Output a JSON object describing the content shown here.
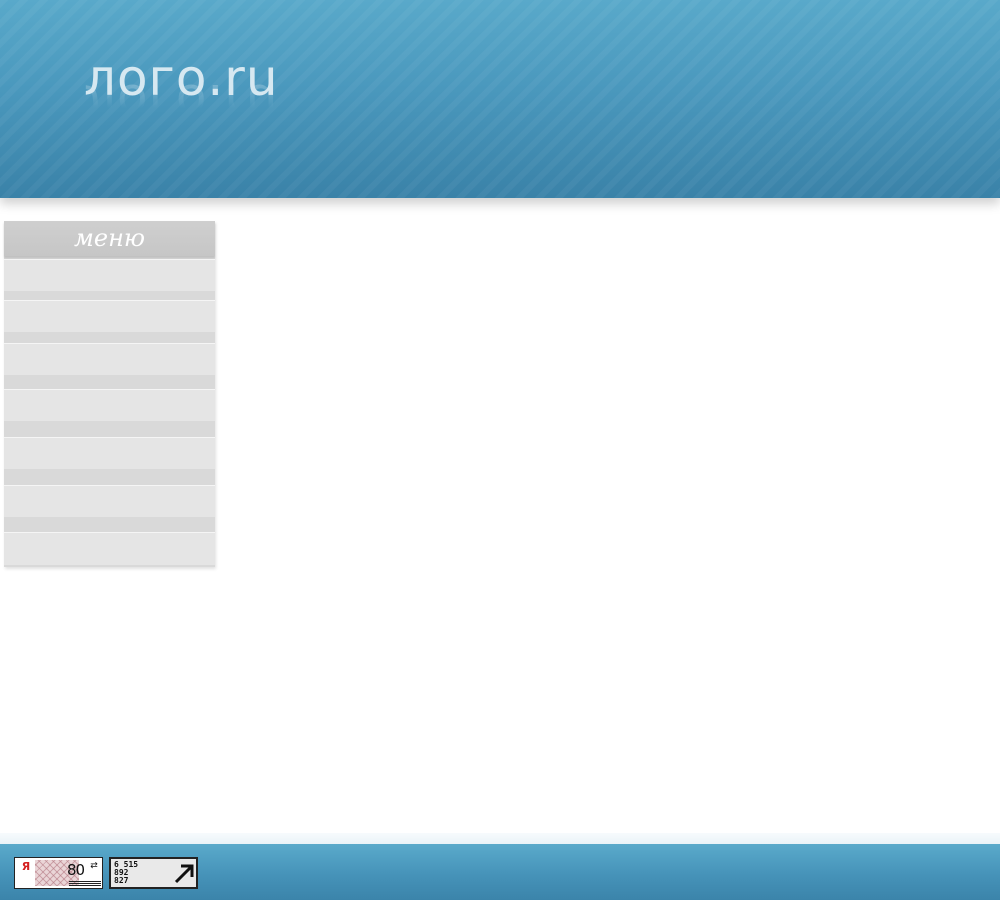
{
  "header": {
    "logo_text": "лого.ru"
  },
  "menu": {
    "title": "меню",
    "items": [
      {
        "label": ""
      },
      {
        "label": ""
      },
      {
        "label": ""
      },
      {
        "label": ""
      },
      {
        "label": ""
      },
      {
        "label": ""
      },
      {
        "label": ""
      }
    ]
  },
  "footer": {
    "counter_yandex": {
      "logo_letter": "Я",
      "value": "80",
      "icon": "refresh-icon"
    },
    "counter_liveinternet": {
      "line1": "6 515",
      "line2": "892",
      "line3": "827",
      "icon": "arrow-up-right-icon"
    }
  },
  "colors": {
    "header_blue": "#4a98bd",
    "footer_blue": "#4693b9",
    "menu_header": "#c9c9c9",
    "menu_item": "#e5e5e5"
  }
}
